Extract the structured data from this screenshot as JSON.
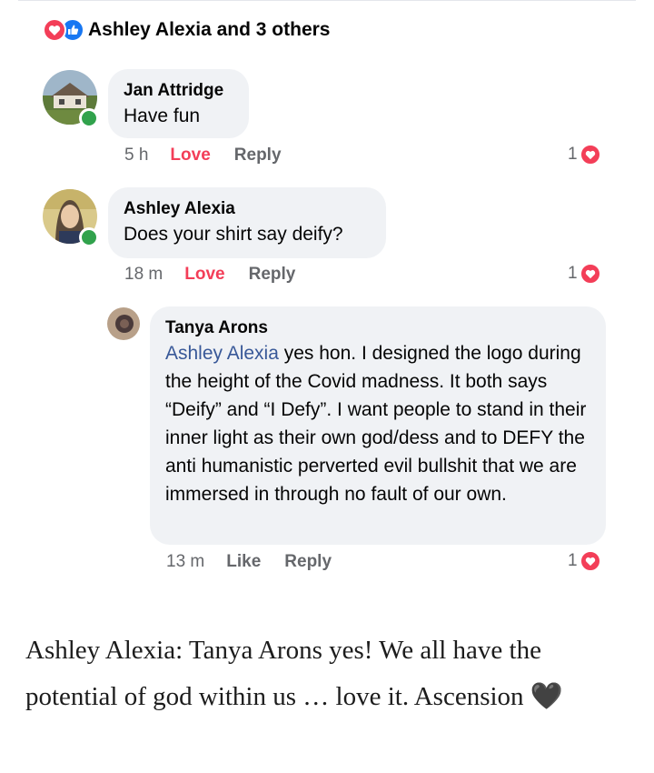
{
  "summary": {
    "text": "Ashley Alexia and 3 others",
    "icons": [
      "love-icon",
      "like-icon"
    ]
  },
  "comments": [
    {
      "author": "Jan Attridge",
      "text": "Have fun",
      "time": "5 h",
      "love_label": "Love",
      "reply_label": "Reply",
      "reaction_count": "1",
      "online": true,
      "avatar": "house-photo"
    },
    {
      "author": "Ashley Alexia",
      "text": "Does your shirt say deify?",
      "time": "18 m",
      "love_label": "Love",
      "reply_label": "Reply",
      "reaction_count": "1",
      "online": true,
      "avatar": "woman-photo"
    }
  ],
  "reply": {
    "author": "Tanya Arons",
    "mention": "Ashley Alexia",
    "text": " yes hon.  I designed the logo during the height of the Covid madness.  It both says “Deify” and “I Defy”.  I want people to stand in their inner light as their own god/dess and to DEFY  the anti humanistic perverted evil bullshit that we are immersed in through no fault of our own.",
    "time": "13 m",
    "like_label": "Like",
    "reply_label": "Reply",
    "reaction_count": "1",
    "avatar": "profile-photo"
  },
  "caption": {
    "text": "Ashley Alexia: Tanya Arons yes! We all have the potential of god within us … love it. Ascension",
    "emoji": "🖤"
  },
  "colors": {
    "love": "#f33e58",
    "like": "#1877f2",
    "online": "#31a24c",
    "bubble": "#f0f2f5",
    "mention": "#385898",
    "meta": "#65676b"
  }
}
